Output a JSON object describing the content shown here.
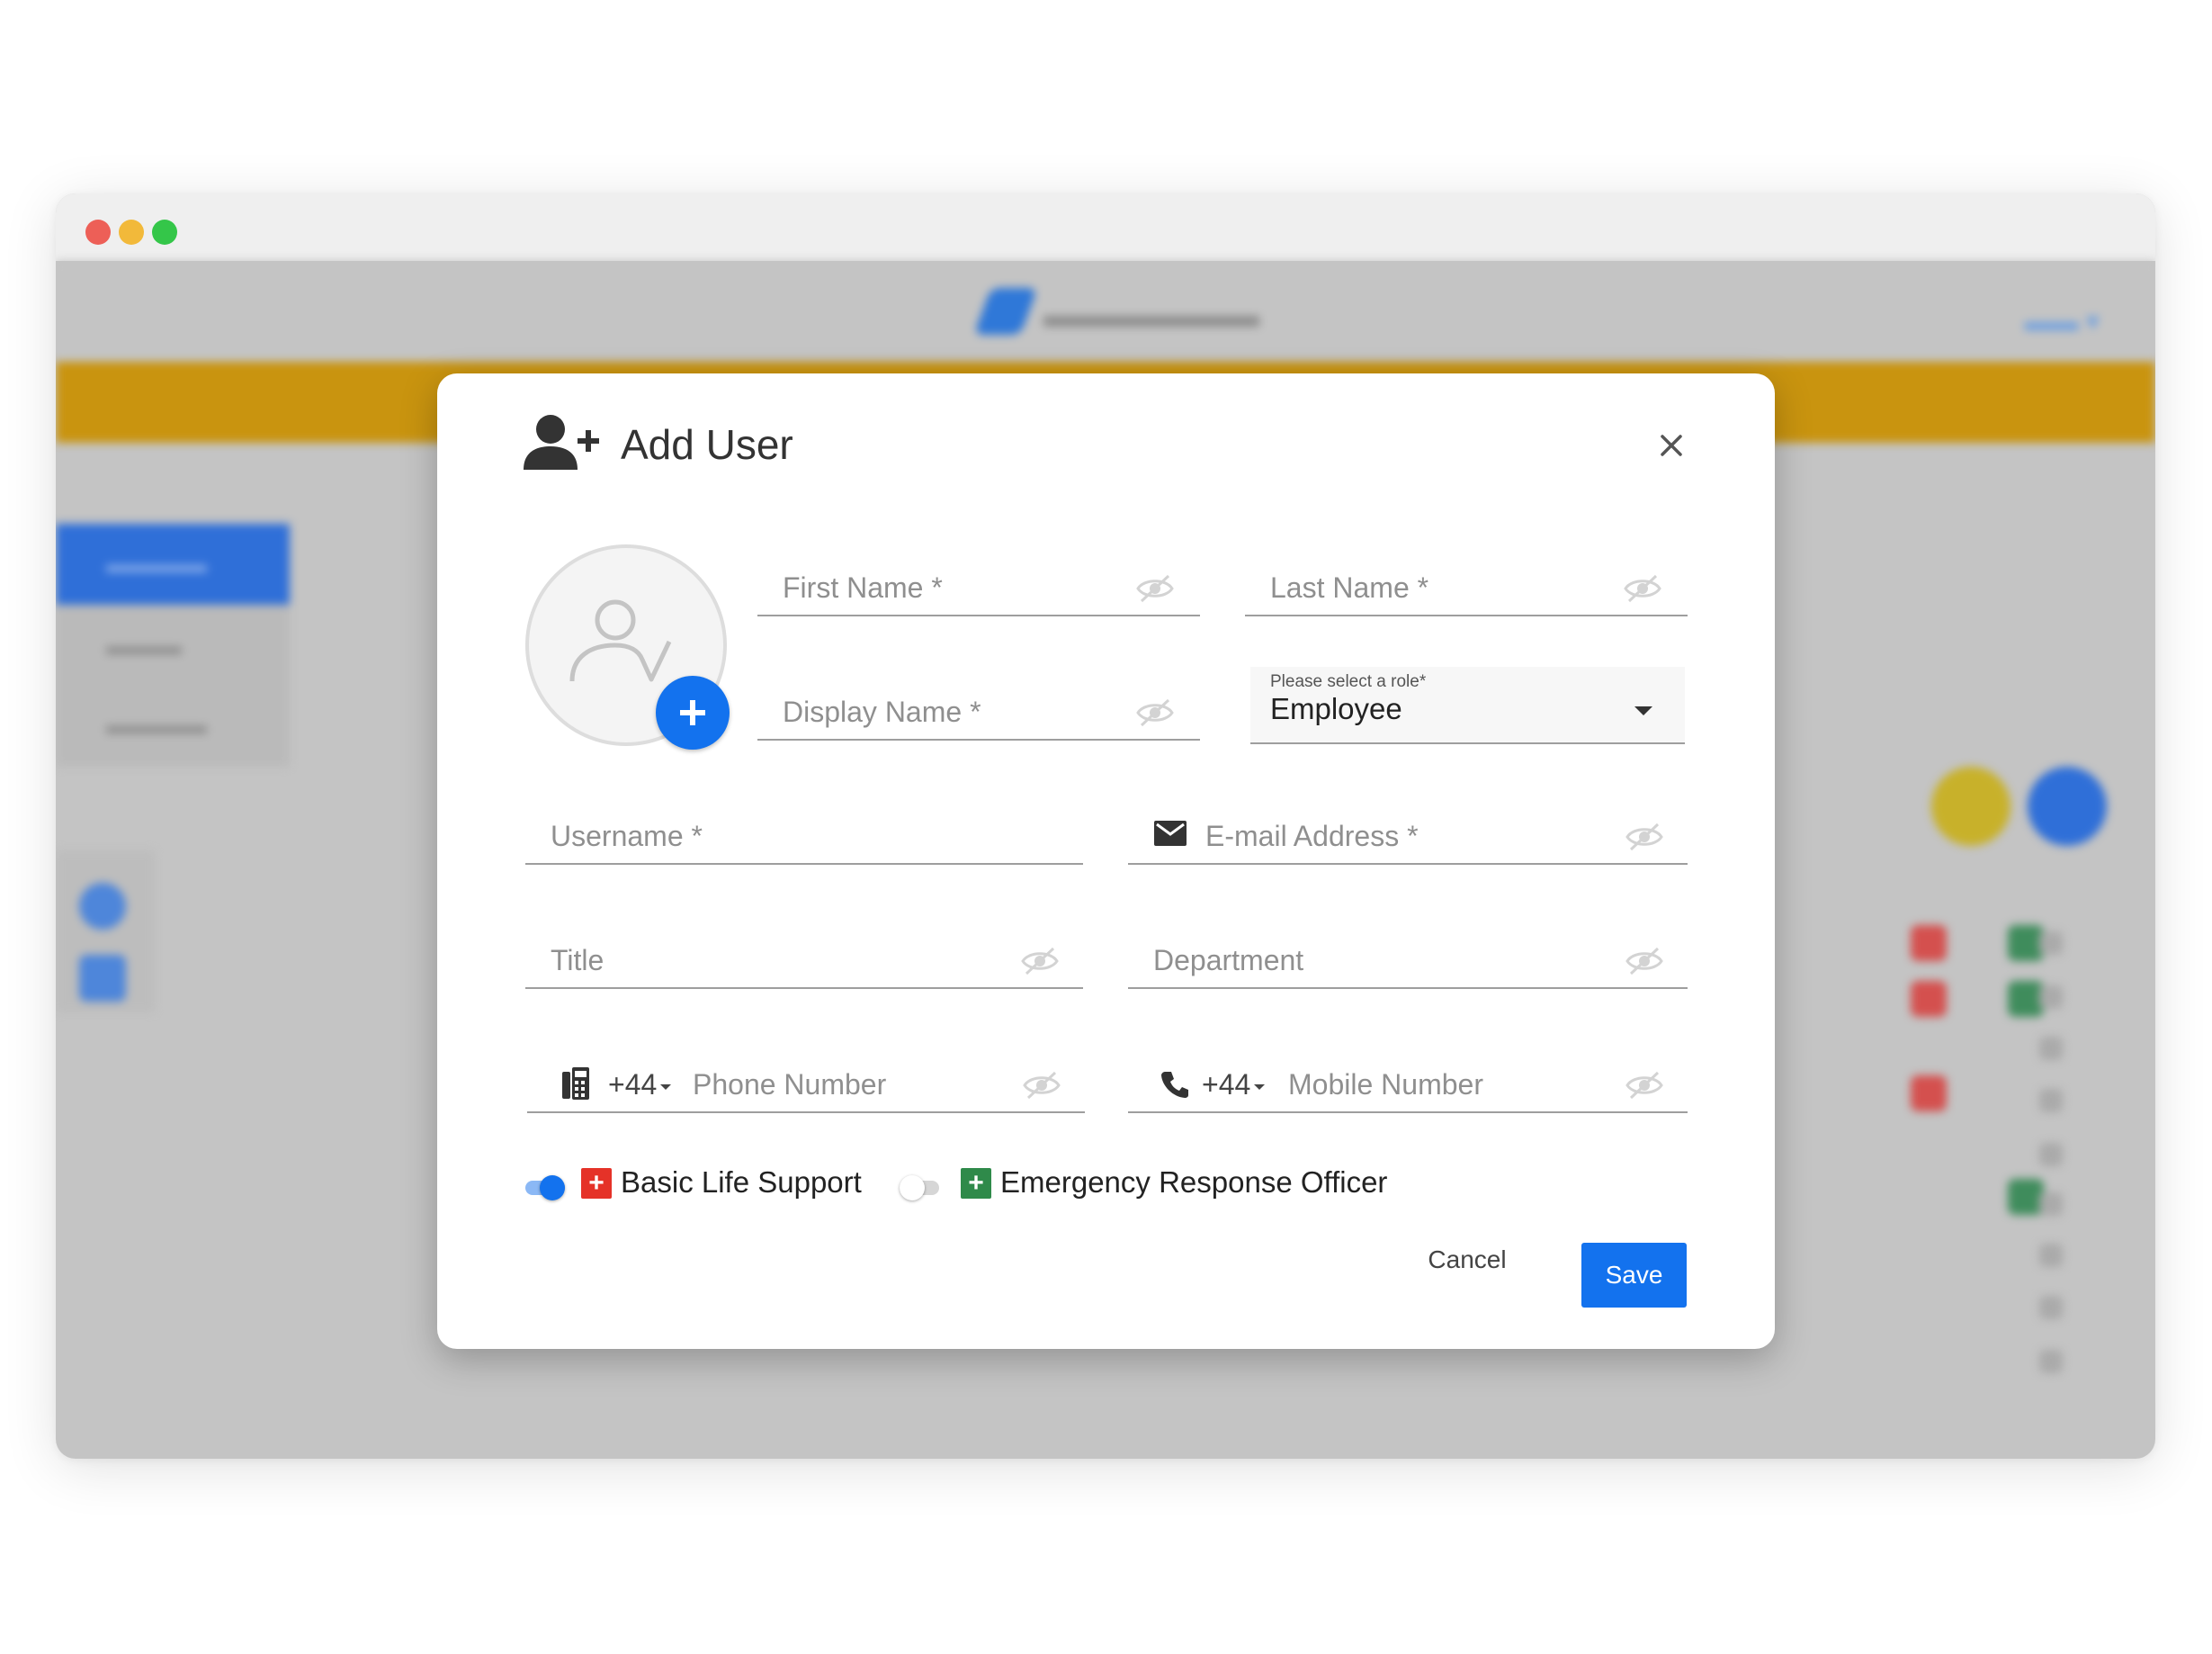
{
  "dialog": {
    "title": "Add User",
    "fields": {
      "first_name": "First Name *",
      "last_name": "Last Name *",
      "display_name": "Display Name *",
      "role_label": "Please select a role*",
      "role_value": "Employee",
      "username": "Username *",
      "email": "E-mail Address *",
      "title": "Title",
      "department": "Department",
      "phone_code": "+44",
      "phone": "Phone Number",
      "mobile_code": "+44",
      "mobile": "Mobile Number"
    },
    "toggles": [
      {
        "label": "Basic Life Support",
        "on": true,
        "badge_color": "#e53228"
      },
      {
        "label": "Emergency Response Officer",
        "on": false,
        "badge_color": "#2f8a4a"
      }
    ],
    "actions": {
      "cancel": "Cancel",
      "save": "Save"
    }
  },
  "colors": {
    "accent": "#1372ee",
    "header_bar": "#c9940f"
  },
  "icons": [
    "add-user-icon",
    "close-icon",
    "avatar-placeholder-icon",
    "plus-icon",
    "eye-off-icon",
    "caret-down-icon",
    "mail-icon",
    "desk-phone-icon",
    "phone-icon"
  ]
}
